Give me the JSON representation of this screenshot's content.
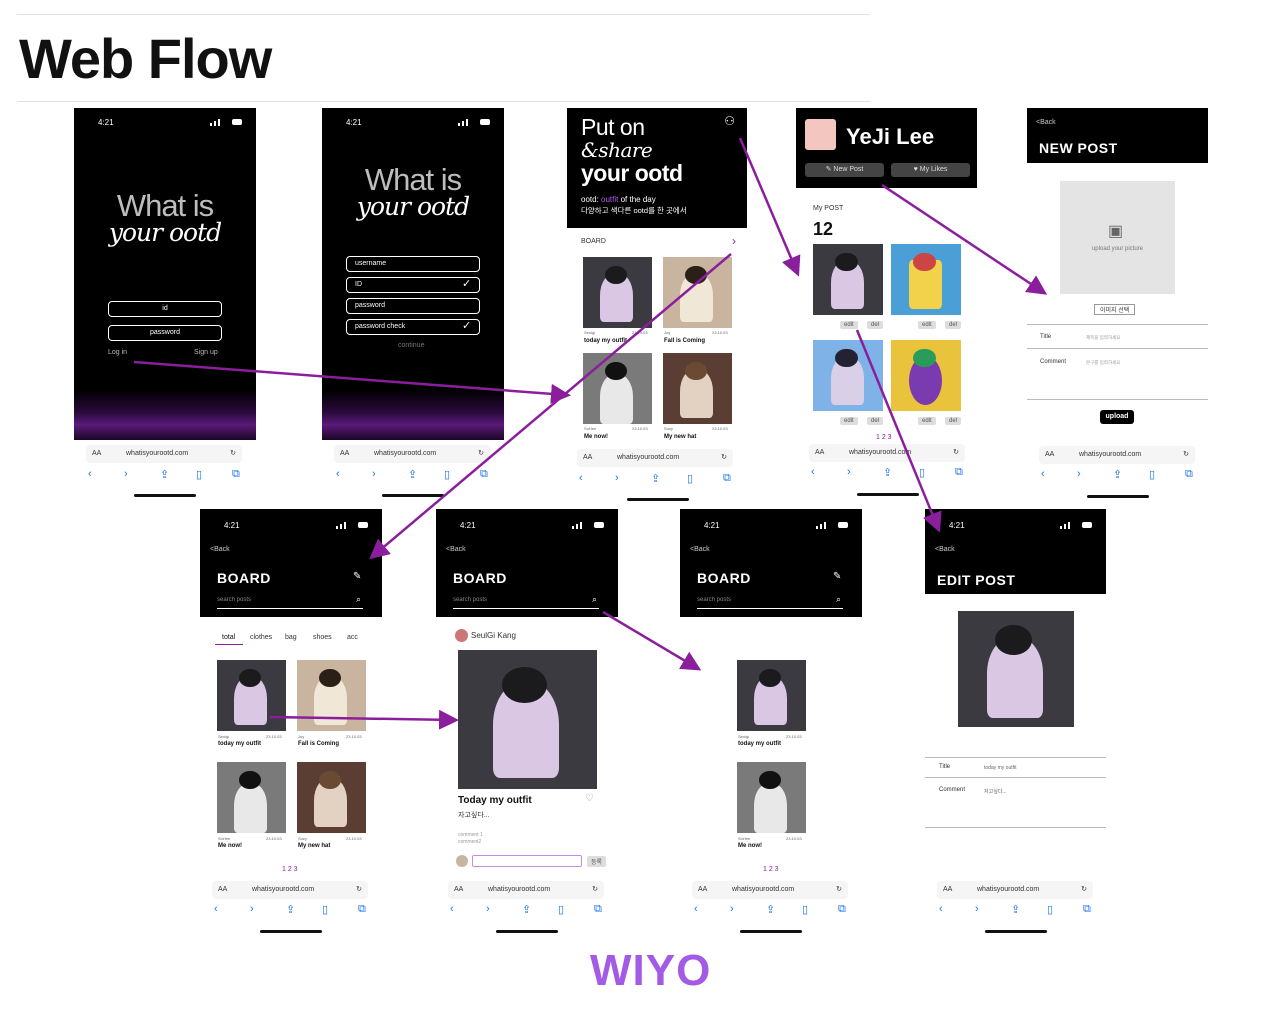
{
  "title": "Web Flow",
  "brand": "WIYO",
  "status_time": "4:21",
  "url": "whatisyourootd.com",
  "aa": "AA",
  "hero_a": "What is",
  "hero_b": "your ootd",
  "login": {
    "id": "id",
    "password": "password",
    "login": "Log in",
    "signup": "Sign up"
  },
  "signup": {
    "username": "username",
    "id": "ID",
    "password": "password",
    "password_check": "password check",
    "continue": "continue"
  },
  "home": {
    "headline_1": "Put on",
    "headline_2": "&share",
    "headline_3": "your ootd",
    "sub_prefix": "ootd: ",
    "sub_accent": "outfit",
    "sub_suffix": " of the day",
    "sub_kr": "다양하고 색다른 ootd를 한 곳에서",
    "board_label": "BOARD",
    "board_more": "›"
  },
  "posts": [
    {
      "author": "Seulgi",
      "date": "23.10.03",
      "title": "today my outfit"
    },
    {
      "author": "Joy",
      "date": "23.10.03",
      "title": "Fall is Coming"
    },
    {
      "author": "SoHee",
      "date": "23.10.03",
      "title": "Me now!"
    },
    {
      "author": "Suzy",
      "date": "23.10.03",
      "title": "My new hat"
    }
  ],
  "profile": {
    "name": "YeJi Lee",
    "new_post": "New Post",
    "my_likes": "My Likes",
    "my_post_label": "My POST",
    "count": "12",
    "edit": "edit",
    "del": "del",
    "pages": "1 2 3"
  },
  "new_post": {
    "back": "<Back",
    "title": "NEW POST",
    "upload_hint": "upload your picture",
    "select": "이미지 선택",
    "title_label": "Title",
    "title_ph": "제목을 입력하세요",
    "comment_label": "Comment",
    "comment_ph": "본구를 입력하세요",
    "upload_btn": "upload"
  },
  "board": {
    "back": "<Back",
    "title": "BOARD",
    "search_ph": "search posts",
    "tabs": [
      "total",
      "clothes",
      "bag",
      "shoes",
      "acc"
    ],
    "pages": "1 2 3"
  },
  "detail": {
    "author": "SeulGi Kang",
    "title": "Today my outfit",
    "body": "자고싶다...",
    "comment_1": "comment 1",
    "comment_2": "comment2",
    "submit": "등록"
  },
  "edit_post": {
    "back": "<Back",
    "title": "EDIT POST",
    "title_label": "Title",
    "title_value": "today my outfit",
    "comment_label": "Comment",
    "comment_value": "자고싶다..."
  },
  "colors": {
    "accent": "#8b1e9c",
    "brand": "#a35be6"
  }
}
